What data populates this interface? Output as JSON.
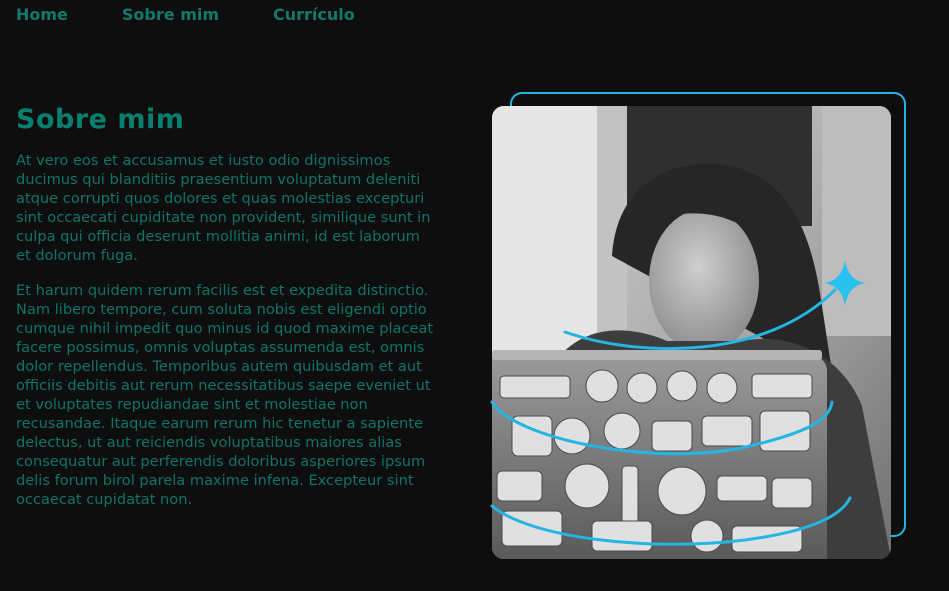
{
  "nav": {
    "items": [
      {
        "label": "Home"
      },
      {
        "label": "Sobre mim"
      },
      {
        "label": "Currículo"
      }
    ]
  },
  "about": {
    "title": "Sobre mim",
    "paragraph1": "At vero eos et accusamus et iusto odio dignissimos ducimus qui blanditiis praesentium voluptatum deleniti atque corrupti quos dolores et quas molestias excepturi sint occaecati cupiditate non provident, similique sunt in culpa qui officia deserunt mollitia animi, id est laborum et dolorum fuga.",
    "paragraph2": "Et harum quidem rerum facilis est et expedita distinctio. Nam libero tempore, cum soluta nobis est eligendi optio cumque nihil impedit quo minus id quod maxime placeat facere possimus, omnis voluptas assumenda est, omnis dolor repellendus. Temporibus autem quibusdam et aut officiis debitis aut rerum necessitatibus saepe eveniet ut et voluptates repudiandae sint et molestiae non recusandae. Itaque earum rerum hic tenetur a sapiente delectus, ut aut reiciendis voluptatibus maiores alias consequatur aut perferendis doloribus asperiores ipsum delis forum birol parela maxime infena. Excepteur sint occaecat cupidatat non."
  },
  "colors": {
    "background": "#0e0e0e",
    "accent_green": "#08806f",
    "accent_blue": "#24b5e3"
  },
  "icons": {
    "sparkle": "sparkle-icon"
  }
}
